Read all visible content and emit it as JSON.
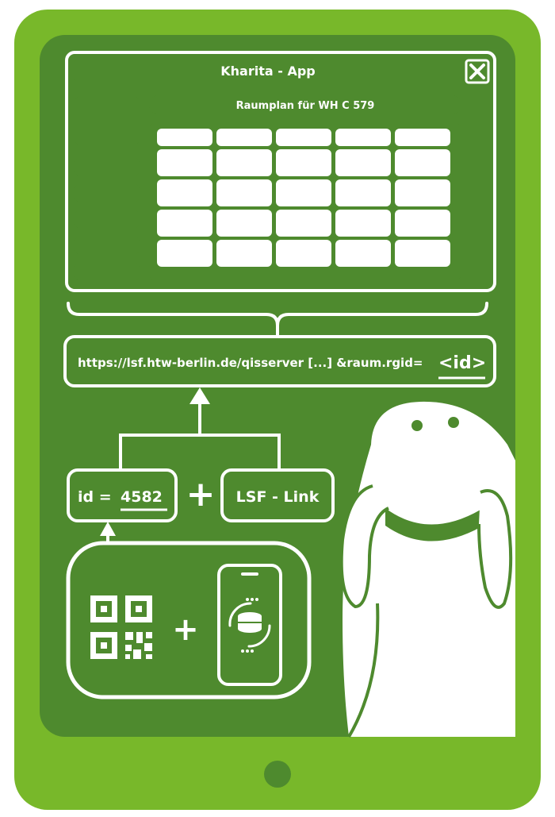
{
  "app": {
    "window_title": "Kharita - App",
    "room_plan_title": "Raumplan für WH C 579",
    "close_icon": "close-icon"
  },
  "url": {
    "text": "https://lsf.htw-berlin.de/qisserver [...] &raum.rgid=",
    "id_token": "<id>"
  },
  "id_box": {
    "prefix": "id = ",
    "value": "4582"
  },
  "lsf_box": {
    "label": "LSF - Link"
  },
  "operators": {
    "plus": "+"
  },
  "icons": [
    "qr-code-icon",
    "smartphone-database-icon",
    "mascot-illustration",
    "home-button-icon"
  ],
  "colors": {
    "tablet_outer": "#78b82a",
    "screen": "#4e8a2e",
    "light": "#ffffff"
  }
}
